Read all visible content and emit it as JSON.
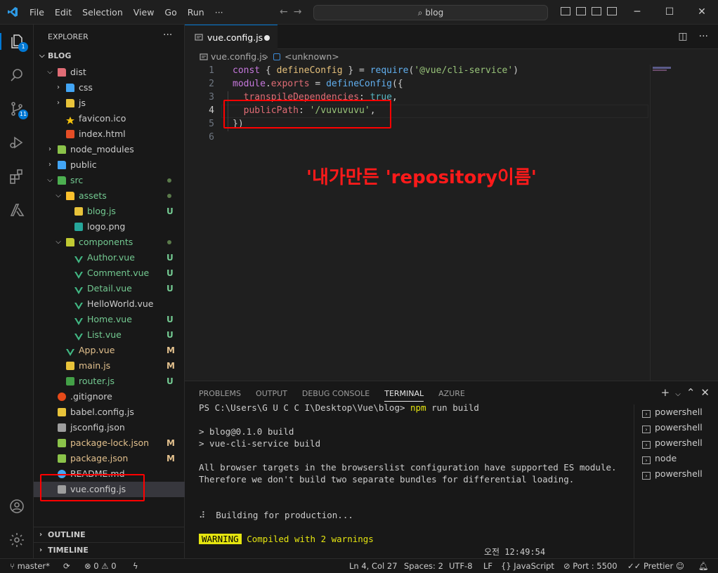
{
  "menu": [
    "File",
    "Edit",
    "Selection",
    "View",
    "Go",
    "Run",
    "···"
  ],
  "search_label": "blog",
  "activity_badges": {
    "explorer": "1",
    "scm": "11"
  },
  "sidebar": {
    "header": "EXPLORER",
    "more": "···",
    "root": "BLOG",
    "tree": [
      {
        "name": "dist",
        "depth": 1,
        "type": "folder",
        "open": true,
        "icon": "folder-dist-icon",
        "color": "#e06c75",
        "status": ""
      },
      {
        "name": "css",
        "depth": 2,
        "type": "folder",
        "open": false,
        "icon": "folder-css-icon",
        "color": "#42a5f5",
        "status": ""
      },
      {
        "name": "js",
        "depth": 2,
        "type": "folder",
        "open": false,
        "icon": "folder-js-icon",
        "color": "#e8c33a",
        "status": ""
      },
      {
        "name": "favicon.ico",
        "depth": 2,
        "type": "file",
        "icon": "star-icon",
        "color": "#f4c20d",
        "status": ""
      },
      {
        "name": "index.html",
        "depth": 2,
        "type": "file",
        "icon": "html-icon",
        "color": "#e44d26",
        "status": ""
      },
      {
        "name": "node_modules",
        "depth": 1,
        "type": "folder",
        "open": false,
        "icon": "folder-node-icon",
        "color": "#8bc34a",
        "status": ""
      },
      {
        "name": "public",
        "depth": 1,
        "type": "folder",
        "open": false,
        "icon": "folder-public-icon",
        "color": "#42a5f5",
        "status": ""
      },
      {
        "name": "src",
        "depth": 1,
        "type": "folder",
        "open": true,
        "icon": "folder-src-icon",
        "color": "#4caf50",
        "status": "dot",
        "labelColor": "#73c991"
      },
      {
        "name": "assets",
        "depth": 2,
        "type": "folder",
        "open": true,
        "icon": "folder-assets-icon",
        "color": "#fbc02d",
        "status": "dot",
        "labelColor": "#73c991"
      },
      {
        "name": "blog.js",
        "depth": 3,
        "type": "file",
        "icon": "js-file-icon",
        "color": "#e8c33a",
        "status": "U",
        "labelColor": "#73c991"
      },
      {
        "name": "logo.png",
        "depth": 3,
        "type": "file",
        "icon": "image-file-icon",
        "color": "#26a69a",
        "status": ""
      },
      {
        "name": "components",
        "depth": 2,
        "type": "folder",
        "open": true,
        "icon": "folder-components-icon",
        "color": "#c0ca33",
        "status": "dot",
        "labelColor": "#73c991"
      },
      {
        "name": "Author.vue",
        "depth": 3,
        "type": "file",
        "icon": "vue-file-icon",
        "color": "#41b883",
        "status": "U",
        "labelColor": "#73c991"
      },
      {
        "name": "Comment.vue",
        "depth": 3,
        "type": "file",
        "icon": "vue-file-icon",
        "color": "#41b883",
        "status": "U",
        "labelColor": "#73c991"
      },
      {
        "name": "Detail.vue",
        "depth": 3,
        "type": "file",
        "icon": "vue-file-icon",
        "color": "#41b883",
        "status": "U",
        "labelColor": "#73c991"
      },
      {
        "name": "HelloWorld.vue",
        "depth": 3,
        "type": "file",
        "icon": "vue-file-icon",
        "color": "#41b883",
        "status": ""
      },
      {
        "name": "Home.vue",
        "depth": 3,
        "type": "file",
        "icon": "vue-file-icon",
        "color": "#41b883",
        "status": "U",
        "labelColor": "#73c991"
      },
      {
        "name": "List.vue",
        "depth": 3,
        "type": "file",
        "icon": "vue-file-icon",
        "color": "#41b883",
        "status": "U",
        "labelColor": "#73c991"
      },
      {
        "name": "App.vue",
        "depth": 2,
        "type": "file",
        "icon": "vue-file-icon",
        "color": "#41b883",
        "status": "M",
        "labelColor": "#e2c08d"
      },
      {
        "name": "main.js",
        "depth": 2,
        "type": "file",
        "icon": "js-file-icon",
        "color": "#e8c33a",
        "status": "M",
        "labelColor": "#e2c08d"
      },
      {
        "name": "router.js",
        "depth": 2,
        "type": "file",
        "icon": "router-file-icon",
        "color": "#43a047",
        "status": "U",
        "labelColor": "#73c991"
      },
      {
        "name": ".gitignore",
        "depth": 1,
        "type": "file",
        "icon": "git-file-icon",
        "color": "#e64a19",
        "status": ""
      },
      {
        "name": "babel.config.js",
        "depth": 1,
        "type": "file",
        "icon": "js-file-icon",
        "color": "#e8c33a",
        "status": ""
      },
      {
        "name": "jsconfig.json",
        "depth": 1,
        "type": "file",
        "icon": "json-file-icon",
        "color": "#9e9e9e",
        "status": ""
      },
      {
        "name": "package-lock.json",
        "depth": 1,
        "type": "file",
        "icon": "node-file-icon",
        "color": "#8bc34a",
        "status": "M",
        "labelColor": "#e2c08d"
      },
      {
        "name": "package.json",
        "depth": 1,
        "type": "file",
        "icon": "node-file-icon",
        "color": "#8bc34a",
        "status": "M",
        "labelColor": "#e2c08d"
      },
      {
        "name": "README.md",
        "depth": 1,
        "type": "file",
        "icon": "info-file-icon",
        "color": "#42a5f5",
        "status": ""
      },
      {
        "name": "vue.config.js",
        "depth": 1,
        "type": "file",
        "icon": "config-file-icon",
        "color": "#9e9e9e",
        "status": "",
        "selected": true
      }
    ],
    "sections": [
      "OUTLINE",
      "TIMELINE"
    ]
  },
  "editor": {
    "tab_label": "vue.config.js",
    "breadcrumb_file": "vue.config.js",
    "breadcrumb_sep": "›",
    "breadcrumb_symbol": "<unknown>",
    "line_numbers": [
      "1",
      "2",
      "3",
      "4",
      "5",
      "6"
    ],
    "code": [
      [
        [
          "k",
          "const"
        ],
        [
          "w",
          " { "
        ],
        [
          "v",
          "defineConfig"
        ],
        [
          "w",
          " } = "
        ],
        [
          "f",
          "require"
        ],
        [
          "w",
          "("
        ],
        [
          "s",
          "'@vue/cli-service'"
        ],
        [
          "w",
          ")"
        ]
      ],
      [
        [
          "k",
          "module"
        ],
        [
          "w",
          "."
        ],
        [
          "p",
          "exports"
        ],
        [
          "w",
          " = "
        ],
        [
          "f",
          "defineConfig"
        ],
        [
          "w",
          "({"
        ]
      ],
      [
        [
          "w",
          "  "
        ],
        [
          "p",
          "transpileDependencies"
        ],
        [
          "w",
          ": "
        ],
        [
          "o",
          "true"
        ],
        [
          "w",
          ","
        ]
      ],
      [
        [
          "w",
          "  "
        ],
        [
          "p",
          "publicPath"
        ],
        [
          "w",
          ": "
        ],
        [
          "s",
          "'/vuvuvuvu'"
        ],
        [
          "w",
          ","
        ]
      ],
      [
        [
          "w",
          "})"
        ]
      ],
      []
    ],
    "annotation": "'내가만든 'repository이름'"
  },
  "panel": {
    "tabs": [
      "PROBLEMS",
      "OUTPUT",
      "DEBUG CONSOLE",
      "TERMINAL",
      "AZURE"
    ],
    "active_tab": "TERMINAL",
    "terminal": {
      "prompt": "PS C:\\Users\\G U C C I\\Desktop\\Vue\\blog> ",
      "cmd_npm": "npm",
      "cmd_rest": " run build",
      "build1": "> blog@0.1.0 build",
      "build2": "> vue-cli-service build",
      "info1": "All browser targets in the browserslist configuration have supported ES module.",
      "info2": "Therefore we don't build two separate bundles for differential loading.",
      "building": "⠼  Building for production...",
      "warning_badge": "WARNING",
      "warning_text": " Compiled with 2 warnings",
      "timestamp": "오전 12:49:54"
    },
    "terminals": [
      "powershell",
      "powershell",
      "powershell",
      "node",
      "powershell"
    ]
  },
  "status": {
    "branch": "master*",
    "errors": "0",
    "warnings": "0",
    "position": "Ln 4, Col 27",
    "spaces": "Spaces: 2",
    "encoding": "UTF-8",
    "eol": "LF",
    "language": "JavaScript",
    "port": "Port : 5500",
    "prettier": "Prettier"
  }
}
